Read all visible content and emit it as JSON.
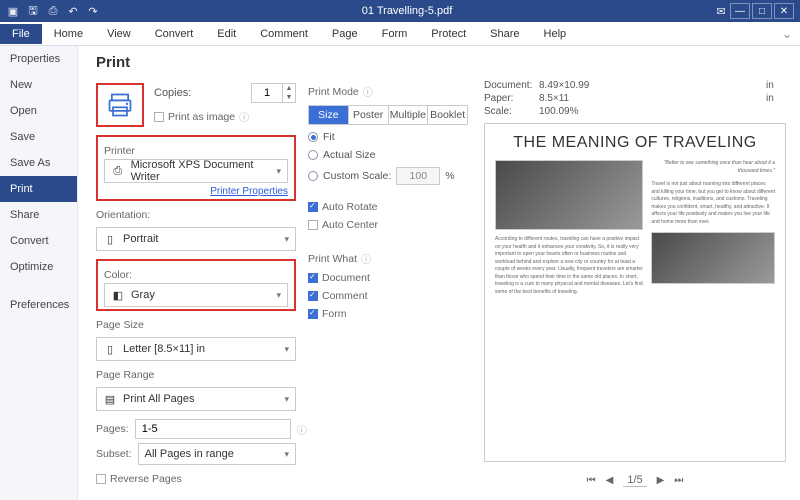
{
  "titlebar": {
    "filename": "01 Travelling-5.pdf"
  },
  "menubar": {
    "items": [
      "File",
      "Home",
      "View",
      "Convert",
      "Edit",
      "Comment",
      "Page",
      "Form",
      "Protect",
      "Share",
      "Help"
    ],
    "active": 0
  },
  "sidebar": {
    "items": [
      "Properties",
      "New",
      "Open",
      "Save",
      "Save As",
      "Print",
      "Share",
      "Convert",
      "Optimize"
    ],
    "active": 5,
    "prefs": "Preferences"
  },
  "print": {
    "title": "Print",
    "copies_label": "Copies:",
    "copies_value": "1",
    "print_as_image": "Print as image",
    "printer_label": "Printer",
    "printer_value": "Microsoft XPS Document Writer",
    "printer_props": "Printer Properties",
    "orientation_label": "Orientation:",
    "orientation_value": "Portrait",
    "color_label": "Color:",
    "color_value": "Gray",
    "pagesize_label": "Page Size",
    "pagesize_value": "Letter [8.5×11] in",
    "pagerange_label": "Page Range",
    "pagerange_value": "Print All Pages",
    "pages_label": "Pages:",
    "pages_value": "1-5",
    "subset_label": "Subset:",
    "subset_value": "All Pages in range",
    "reverse": "Reverse Pages"
  },
  "mode": {
    "label": "Print Mode",
    "segments": [
      "Size",
      "Poster",
      "Multiple",
      "Booklet"
    ],
    "active": 0,
    "fit": "Fit",
    "actual": "Actual Size",
    "custom": "Custom Scale:",
    "custom_value": "100",
    "pct": "%",
    "auto_rotate": "Auto Rotate",
    "auto_center": "Auto Center",
    "printwhat": "Print What",
    "pw_document": "Document",
    "pw_comment": "Comment",
    "pw_form": "Form"
  },
  "preview": {
    "doc_label": "Document:",
    "doc_val": "8.49×10.99",
    "doc_unit": "in",
    "paper_label": "Paper:",
    "paper_val": "8.5×11",
    "paper_unit": "in",
    "scale_label": "Scale:",
    "scale_val": "100.09%",
    "page_title": "THE MEANING OF TRAVELING",
    "page_current": "1",
    "page_total": "/5"
  }
}
